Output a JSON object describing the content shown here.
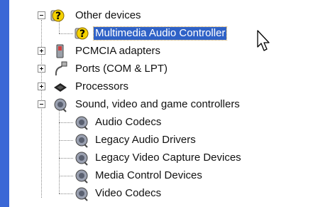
{
  "tree": {
    "other_devices": {
      "label": "Other devices",
      "icon": "question-device-icon"
    },
    "multimedia_audio_controller": {
      "label": "Multimedia Audio Controller",
      "icon": "question-device-icon"
    },
    "pcmcia_adapters": {
      "label": "PCMCIA adapters",
      "icon": "pcmcia-card-icon"
    },
    "ports": {
      "label": "Ports (COM & LPT)",
      "icon": "port-cable-icon"
    },
    "processors": {
      "label": "Processors",
      "icon": "processor-chip-icon"
    },
    "sound": {
      "label": "Sound, video and game controllers",
      "icon": "speaker-icon",
      "children": [
        {
          "label": "Audio Codecs",
          "icon": "speaker-icon"
        },
        {
          "label": "Legacy Audio Drivers",
          "icon": "speaker-icon"
        },
        {
          "label": "Legacy Video Capture Devices",
          "icon": "speaker-icon"
        },
        {
          "label": "Media Control Devices",
          "icon": "speaker-icon"
        },
        {
          "label": "Video Codecs",
          "icon": "speaker-icon"
        }
      ]
    }
  },
  "colors": {
    "selection": "#2f62c7",
    "window_edge": "#3a67d6"
  }
}
